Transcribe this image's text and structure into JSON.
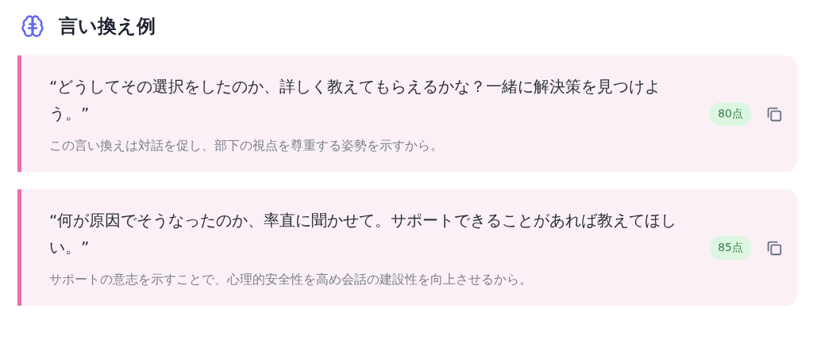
{
  "heading": {
    "title": "言い換え例"
  },
  "examples": [
    {
      "quote": "“どうしてその選択をしたのか、詳しく教えてもらえるかな？一緒に解決策を見つけよう。”",
      "score": "80点",
      "reason": "この言い換えは対話を促し、部下の視点を尊重する姿勢を示すから。"
    },
    {
      "quote": "“何が原因でそうなったのか、率直に聞かせて。サポートできることがあれば教えてほしい。”",
      "score": "85点",
      "reason": "サポートの意志を示すことで、心理的安全性を高め会話の建設性を向上させるから。"
    }
  ]
}
